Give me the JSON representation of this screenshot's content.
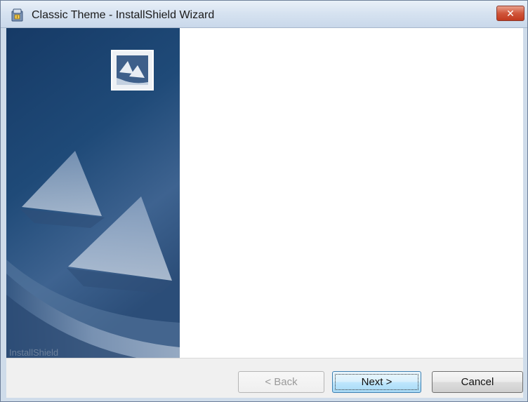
{
  "window": {
    "title": "Classic Theme - InstallShield Wizard",
    "close_label": "✕"
  },
  "side_panel": {
    "watermark_text": "InstallShield"
  },
  "buttons": {
    "back_label": "< Back",
    "next_label": "Next >",
    "cancel_label": "Cancel",
    "back_enabled": false,
    "next_default": true
  },
  "colors": {
    "side_panel_dark": "#1b3f6b",
    "side_panel_light": "#5d7fa6",
    "titlebar": "#d7e3f1",
    "close_button": "#c9462b",
    "default_button_border": "#3c7fb1"
  },
  "icons": [
    "installer-icon",
    "close-icon",
    "installshield-logo-icon"
  ]
}
